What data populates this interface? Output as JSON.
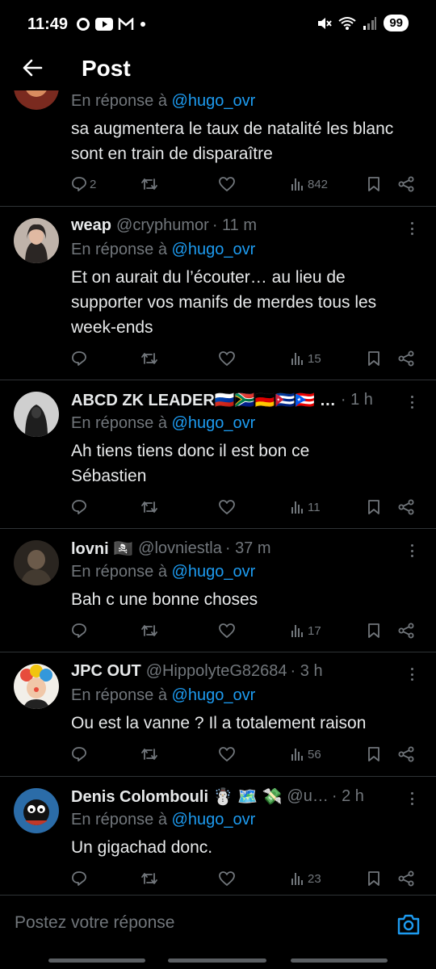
{
  "status_bar": {
    "time": "11:49",
    "battery": "99"
  },
  "header": {
    "title": "Post"
  },
  "reply_prefix": "En réponse à",
  "replies": [
    {
      "name": "",
      "handle": "",
      "time": "",
      "replying_to": "@hugo_ovr",
      "text": "sa augmentera le taux de natalité les blanc sont en train de disparaître",
      "reply_count": "2",
      "views": "842",
      "avatar_color": "#c0392b"
    },
    {
      "name": "weap",
      "handle": "@cryphumor",
      "time": "11 m",
      "replying_to": "@hugo_ovr",
      "text": "Et on aurait du l’écouter… au lieu de supporter vos manifs de merdes tous les week-ends",
      "reply_count": "",
      "views": "15",
      "avatar_color": "#8a6a5c"
    },
    {
      "name": "ABCD ZK LEADER🇷🇺🇿🇦🇩🇪🇨🇺🇵🇷 …",
      "handle": "",
      "time": "1 h",
      "replying_to": "@hugo_ovr",
      "text": "Ah tiens tiens donc il est bon ce Sébastien",
      "reply_count": "",
      "views": "11",
      "avatar_color": "#3a3a3a"
    },
    {
      "name": "lovni 🏴‍☠️",
      "handle": "@lovniestla",
      "time": "37 m",
      "replying_to": "@hugo_ovr",
      "text": "Bah c une bonne choses",
      "reply_count": "",
      "views": "17",
      "avatar_color": "#2b2620"
    },
    {
      "name": "JPC OUT",
      "handle": "@HippolyteG82684",
      "time": "3 h",
      "replying_to": "@hugo_ovr",
      "text": "Ou est la vanne ? Il a totalement raison",
      "reply_count": "",
      "views": "56",
      "avatar_color": "#e8e2da"
    },
    {
      "name": "Denis Colombouli ☃️ 🗺️ 💸",
      "handle": "@u…",
      "time": "2 h",
      "replying_to": "@hugo_ovr",
      "text": "Un gigachad donc.",
      "reply_count": "",
      "views": "23",
      "avatar_color": "#2b6ca8"
    }
  ],
  "compose": {
    "placeholder": "Postez votre réponse"
  },
  "colors": {
    "accent": "#1d9bf0",
    "muted": "#71767b",
    "divider": "#2f3336"
  }
}
